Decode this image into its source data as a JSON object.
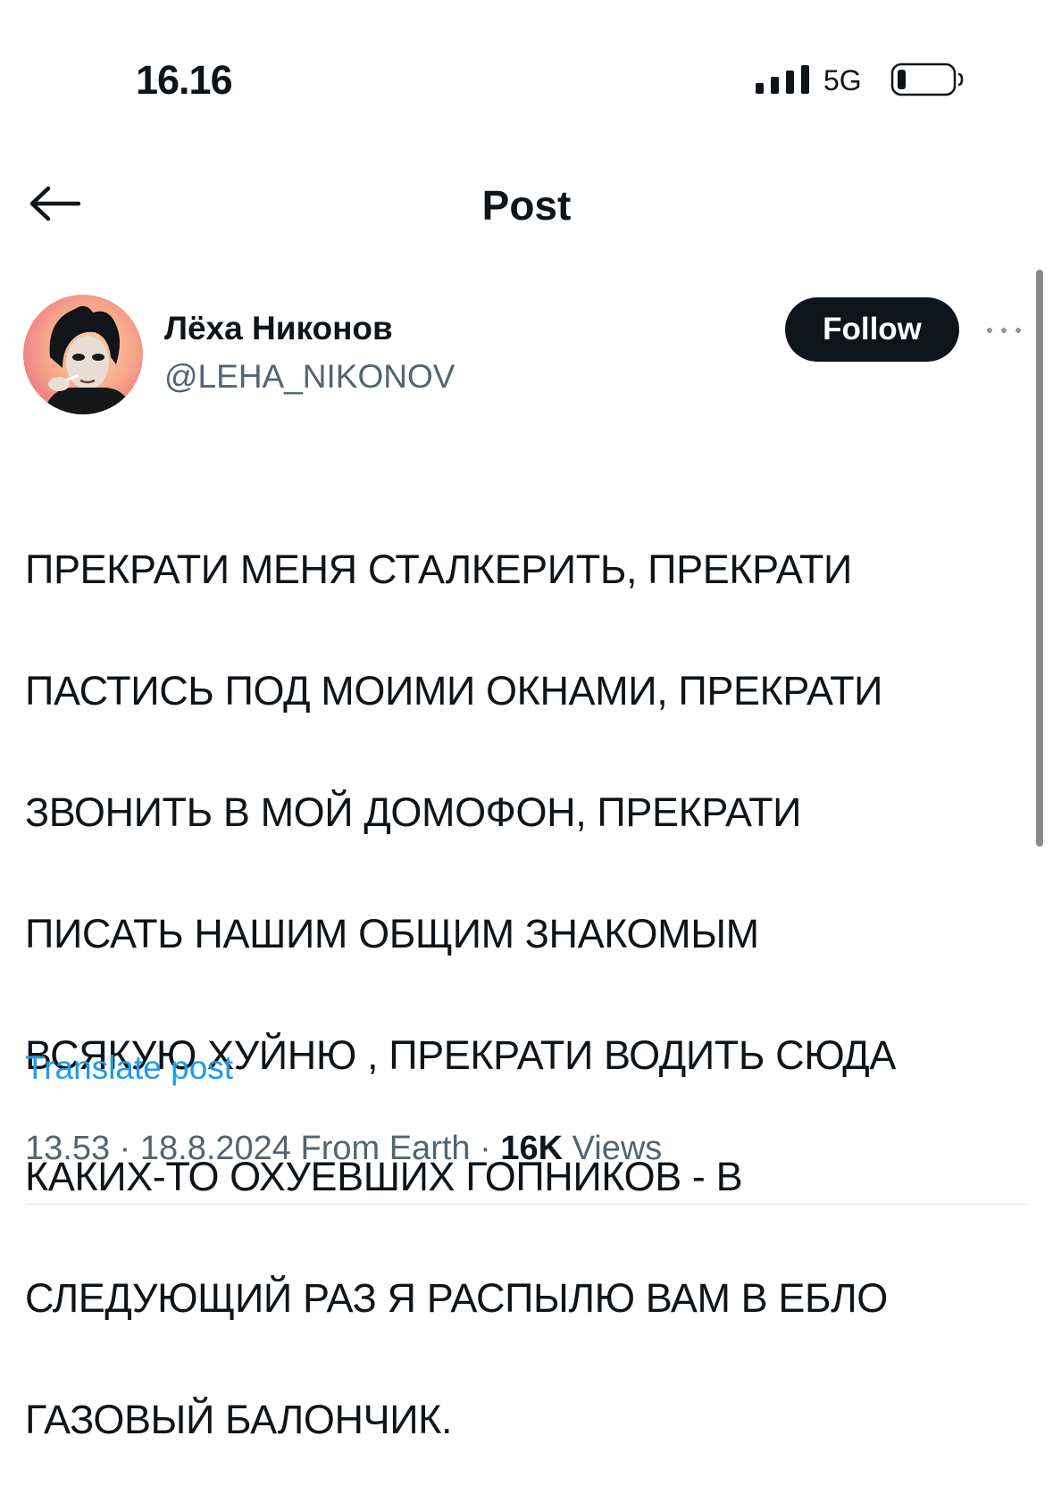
{
  "status_bar": {
    "time": "16.16",
    "network": "5G",
    "icons": [
      "signal-bars-icon",
      "battery-icon"
    ]
  },
  "header": {
    "title": "Post",
    "back_icon": "arrow-left-icon"
  },
  "post": {
    "author_name": "Лёха Никонов",
    "author_handle": "@LEHA_NIKONOV",
    "follow_label": "Follow",
    "more_icon": "more-horizontal-icon",
    "text_lines": [
      "ПРЕКРАТИ МЕНЯ СТАЛКЕРИТЬ, ПРЕКРАТИ",
      "ПАСТИСЬ ПОД МОИМИ ОКНАМИ, ПРЕКРАТИ",
      "ЗВОНИТЬ В МОЙ ДОМОФОН, ПРЕКРАТИ",
      "ПИСАТЬ НАШИМ ОБЩИМ ЗНАКОМЫМ",
      "ВСЯКУЮ ХУЙНЮ , ПРЕКРАТИ ВОДИТЬ СЮДА",
      "КАКИХ-ТО ОХУЕВШИХ ГОПНИКОВ - В",
      "СЛЕДУЮЩИЙ РАЗ Я РАСПЫЛЮ ВАМ В ЕБЛО",
      "ГАЗОВЫЙ БАЛОНЧИК."
    ],
    "translate_label": "Translate post",
    "time": "13.53",
    "date": "18.8.2024",
    "source": "From Earth",
    "separator": "·",
    "views_count": "16K",
    "views_label": "Views"
  },
  "colors": {
    "text_primary": "#0f1419",
    "text_secondary": "#536471",
    "link": "#1d9bf0",
    "button_bg": "#0f1419"
  }
}
